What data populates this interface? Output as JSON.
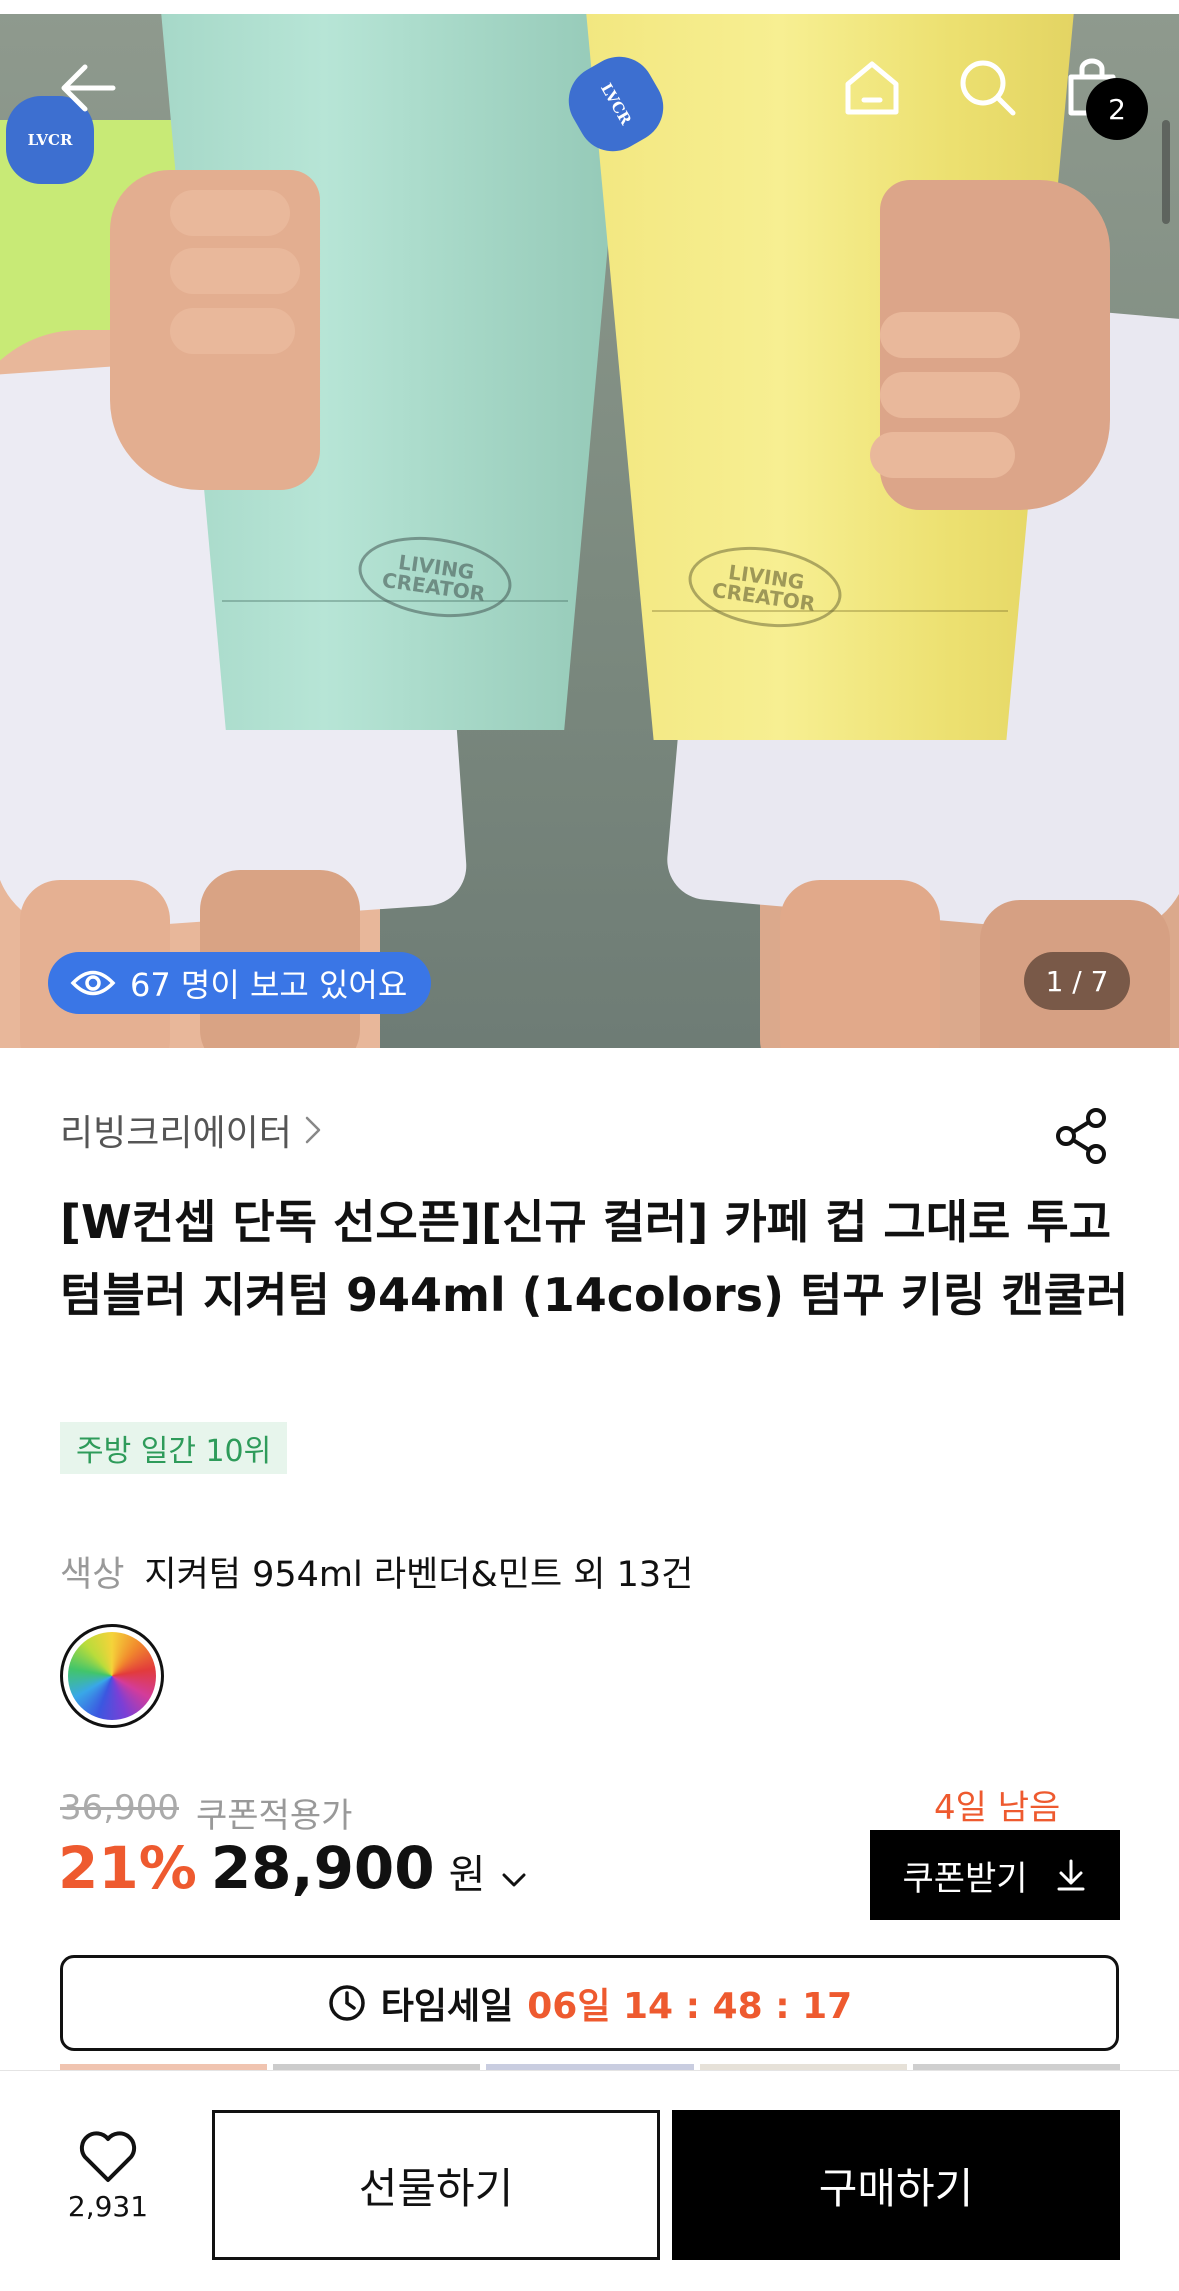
{
  "hero": {
    "viewers_text": "67 명이 보고 있어요",
    "image_counter": "1 / 7",
    "cart_count": "2",
    "charm_text": "LVCR",
    "cup_logo_line1": "LIVING",
    "cup_logo_line2": "CREATOR"
  },
  "product": {
    "brand": "리빙크리에이터",
    "title": "[W컨셉 단독 선오픈][신규 컬러] 카페 컵 그대로 투고 텀블러 지켜텀 944ml (14colors) 텀꾸 키링 캔쿨러",
    "rank_badge": "주방 일간 10위",
    "color_label": "색상",
    "color_value": "지켜텀 954ml 라벤더&민트 외 13건"
  },
  "pricing": {
    "original_price": "36,900",
    "coupon_price_label": "쿠폰적용가",
    "discount": "21%",
    "price": "28,900",
    "currency": "원",
    "days_left": "4일 남음",
    "coupon_button": "쿠폰받기"
  },
  "timesale": {
    "label": "타임세일",
    "time": "06일 14 : 48 : 17"
  },
  "bottom_bar": {
    "like_count": "2,931",
    "gift_button": "선물하기",
    "buy_button": "구매하기"
  },
  "colors": {
    "accent_orange": "#ee5a2f",
    "viewers_blue": "#3a76e6",
    "rank_green": "#2e9b5a"
  }
}
